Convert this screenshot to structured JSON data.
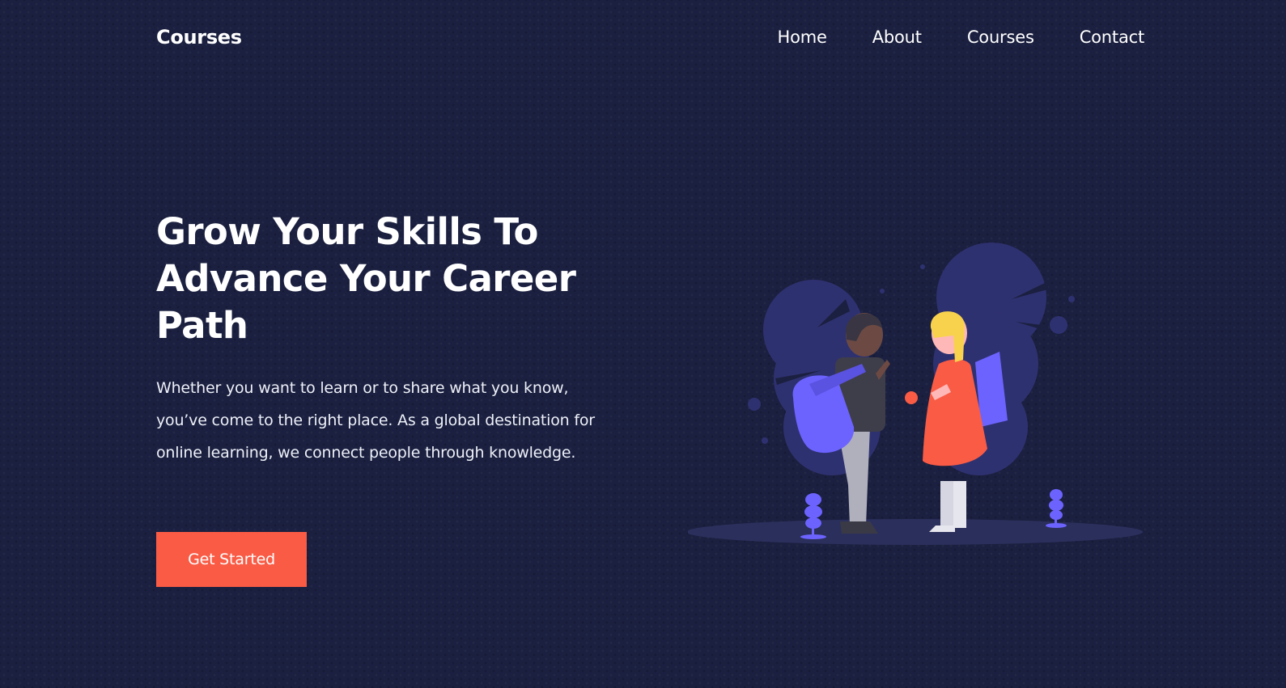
{
  "header": {
    "logo": "Courses",
    "nav": {
      "home": "Home",
      "about": "About",
      "courses": "Courses",
      "contact": "Contact"
    }
  },
  "hero": {
    "title": "Grow Your Skills To Advance Your Career Path",
    "description": "Whether you want to learn or to share what you know, you’ve come to the right place. As a global destination for online learning, we connect people through knowledge.",
    "cta_label": "Get Started"
  },
  "colors": {
    "background": "#1b2040",
    "accent": "#f95b45",
    "illustration_primary": "#6c63ff",
    "illustration_shadow": "#2b2f5c"
  }
}
